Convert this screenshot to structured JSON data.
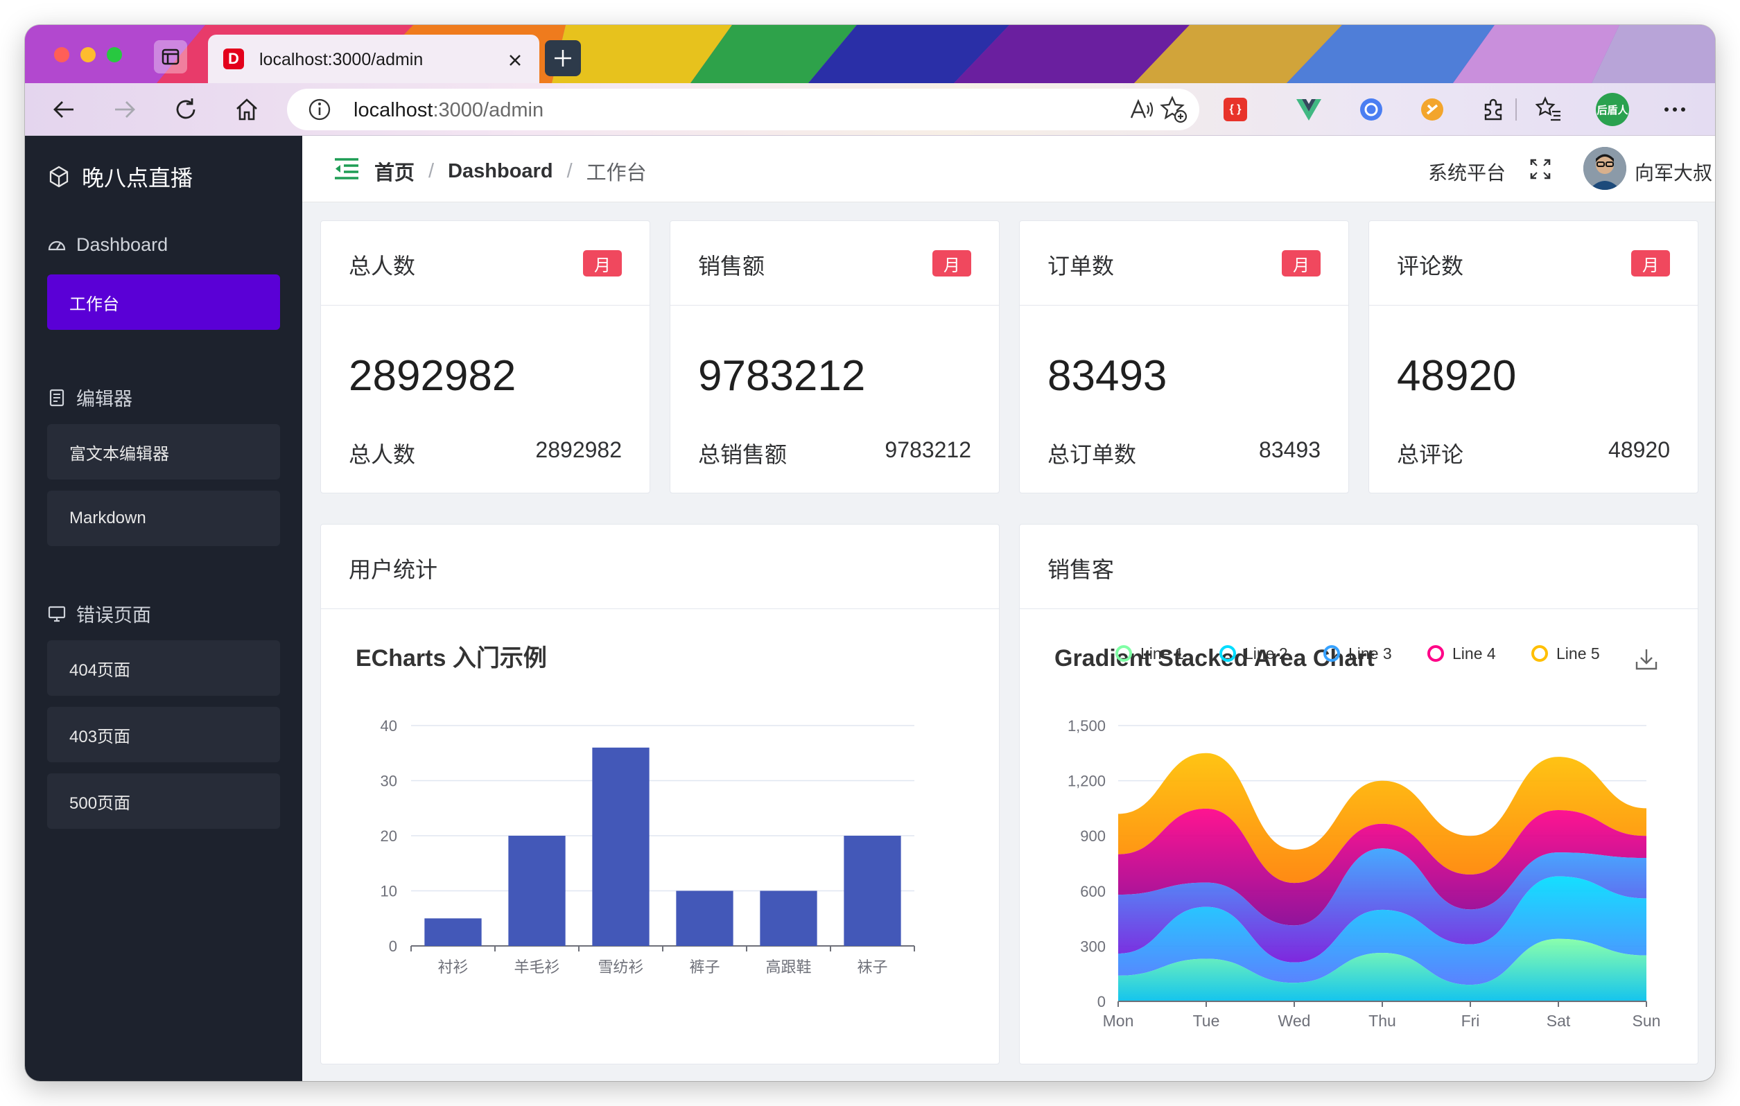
{
  "browser": {
    "tab_title": "localhost:3000/admin",
    "url_host": "localhost",
    "url_rest": ":3000/admin",
    "profile_label": "后盾人"
  },
  "sidebar": {
    "brand": "晚八点直播",
    "groups": [
      {
        "label": "Dashboard",
        "icon": "dashboard-icon",
        "items": [
          {
            "label": "工作台",
            "active": true
          }
        ]
      },
      {
        "label": "编辑器",
        "icon": "document-icon",
        "items": [
          {
            "label": "富文本编辑器"
          },
          {
            "label": "Markdown"
          }
        ]
      },
      {
        "label": "错误页面",
        "icon": "monitor-icon",
        "items": [
          {
            "label": "404页面"
          },
          {
            "label": "403页面"
          },
          {
            "label": "500页面"
          }
        ]
      }
    ]
  },
  "header": {
    "breadcrumb": [
      "首页",
      "Dashboard",
      "工作台"
    ],
    "separator": "/",
    "platform": "系统平台",
    "username": "向军大叔"
  },
  "stats": [
    {
      "title": "总人数",
      "badge": "月",
      "value": "2892982",
      "foot_label": "总人数",
      "foot_value": "2892982"
    },
    {
      "title": "销售额",
      "badge": "月",
      "value": "9783212",
      "foot_label": "总销售额",
      "foot_value": "9783212"
    },
    {
      "title": "订单数",
      "badge": "月",
      "value": "83493",
      "foot_label": "总订单数",
      "foot_value": "83493"
    },
    {
      "title": "评论数",
      "badge": "月",
      "value": "48920",
      "foot_label": "总评论",
      "foot_value": "48920"
    }
  ],
  "panels": {
    "left_title": "用户统计",
    "right_title": "销售客"
  },
  "colors": {
    "accent": "#5a00d6",
    "sidebar_bg": "#1d222d",
    "badge": "#f0485e",
    "bar": "#4358b8"
  },
  "chart_data": [
    {
      "type": "bar",
      "title": "ECharts 入门示例",
      "categories": [
        "衬衫",
        "羊毛衫",
        "雪纺衫",
        "裤子",
        "高跟鞋",
        "袜子"
      ],
      "values": [
        5,
        20,
        36,
        10,
        10,
        20
      ],
      "ylim": [
        0,
        40
      ],
      "yticks": [
        0,
        10,
        20,
        30,
        40
      ],
      "grid": true
    },
    {
      "type": "area",
      "title": "Gradient Stacked Area Chart",
      "stacked": true,
      "x": [
        "Mon",
        "Tue",
        "Wed",
        "Thu",
        "Fri",
        "Sat",
        "Sun"
      ],
      "ylim": [
        0,
        1500
      ],
      "yticks": [
        0,
        300,
        600,
        900,
        1200,
        1500
      ],
      "legend_position": "top-right",
      "series": [
        {
          "name": "Line 1",
          "color": "#80ffa5",
          "values": [
            140,
            232,
            101,
            264,
            90,
            340,
            250
          ]
        },
        {
          "name": "Line 2",
          "color": "#00ddff",
          "values": [
            120,
            282,
            111,
            234,
            220,
            340,
            310
          ]
        },
        {
          "name": "Line 3",
          "color": "#37a2ff",
          "values": [
            320,
            132,
            201,
            334,
            190,
            130,
            220
          ]
        },
        {
          "name": "Line 4",
          "color": "#ff0087",
          "values": [
            220,
            402,
            231,
            134,
            190,
            230,
            120
          ]
        },
        {
          "name": "Line 5",
          "color": "#ffbf00",
          "values": [
            220,
            302,
            181,
            234,
            210,
            290,
            150
          ]
        }
      ]
    }
  ]
}
